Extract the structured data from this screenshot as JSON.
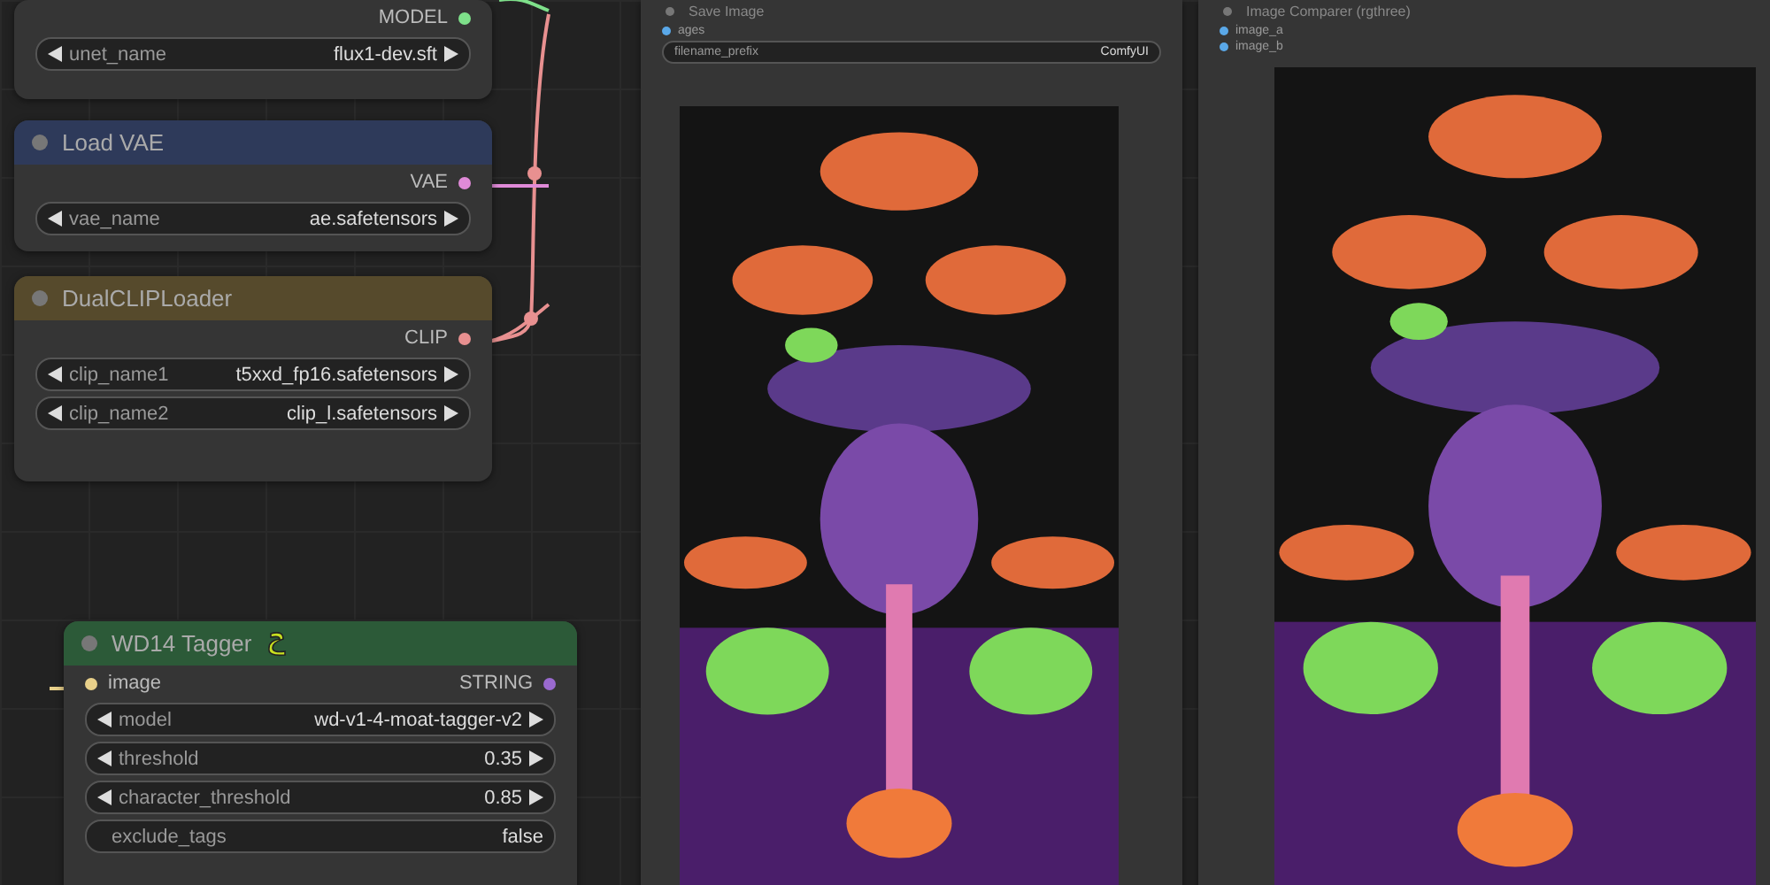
{
  "nodes": [
    {
      "outputs": [
        {
          "label": "MODEL",
          "color": "#7ee08a"
        }
      ],
      "widgets": [
        {
          "kind": "combo",
          "label": "unet_name",
          "value": "flux1-dev.sft"
        }
      ]
    },
    {
      "title": "Load VAE",
      "color": "#2e3a5a",
      "outputs": [
        {
          "label": "VAE",
          "color": "#e08ad8"
        }
      ],
      "widgets": [
        {
          "kind": "combo",
          "label": "vae_name",
          "value": "ae.safetensors"
        }
      ]
    },
    {
      "title": "DualCLIPLoader",
      "color": "#564a2c",
      "outputs": [
        {
          "label": "CLIP",
          "color": "#e89090"
        }
      ],
      "widgets": [
        {
          "kind": "combo",
          "label": "clip_name1",
          "value": "t5xxd_fp16.safetensors"
        },
        {
          "kind": "combo",
          "label": "clip_name2",
          "value": "clip_l.safetensors"
        }
      ]
    },
    {
      "title": "WD14 Tagger",
      "color": "#2c5a38",
      "badge": true,
      "inputs": [
        {
          "label": "image",
          "color": "#e8d08a"
        }
      ],
      "outputs": [
        {
          "label": "STRING",
          "color": "#9a6ad0"
        }
      ],
      "widgets": [
        {
          "kind": "combo",
          "label": "model",
          "value": "wd-v1-4-moat-tagger-v2"
        },
        {
          "kind": "number",
          "label": "threshold",
          "value": "0.35"
        },
        {
          "kind": "number",
          "label": "character_threshold",
          "value": "0.85"
        },
        {
          "kind": "toggle",
          "label": "exclude_tags",
          "value": "false"
        }
      ]
    },
    {
      "title": "Save Image",
      "color": "#353535",
      "inputs": [
        {
          "label": "ages",
          "color": "#5aa8e8"
        }
      ],
      "widgets": [
        {
          "kind": "text",
          "label": "filename_prefix",
          "value": "ComfyUI"
        }
      ],
      "picture": {
        "kind": "picture"
      }
    },
    {
      "title": "Image Comparer (rgthree)",
      "color": "#353535",
      "inputs": [
        {
          "label": "image_a",
          "color": "#5aa8e8"
        },
        {
          "label": "image_b",
          "color": "#5aa8e8"
        }
      ],
      "picture": {
        "kind": "picture"
      }
    }
  ]
}
